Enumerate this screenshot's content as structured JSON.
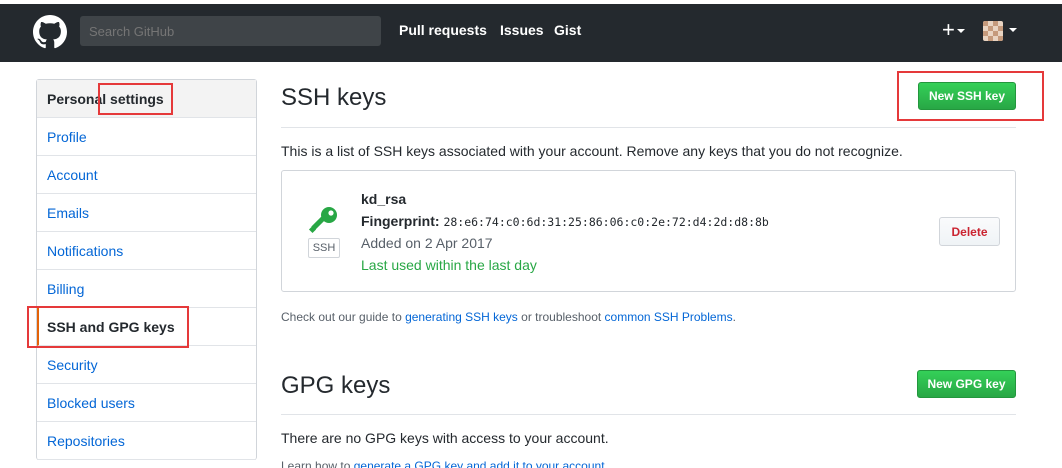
{
  "header": {
    "search_placeholder": "Search GitHub",
    "nav": [
      "Pull requests",
      "Issues",
      "Gist"
    ],
    "plus_label": "+"
  },
  "sidebar": {
    "title": "Personal settings",
    "items": [
      {
        "label": "Profile"
      },
      {
        "label": "Account"
      },
      {
        "label": "Emails"
      },
      {
        "label": "Notifications"
      },
      {
        "label": "Billing"
      },
      {
        "label": "SSH and GPG keys"
      },
      {
        "label": "Security"
      },
      {
        "label": "Blocked users"
      },
      {
        "label": "Repositories"
      }
    ]
  },
  "ssh": {
    "title": "SSH keys",
    "new_button": "New SSH key",
    "description": "This is a list of SSH keys associated with your account. Remove any keys that you do not recognize.",
    "key": {
      "name": "kd_rsa",
      "fingerprint_label": "Fingerprint:",
      "fingerprint": "28:e6:74:c0:6d:31:25:86:06:c0:2e:72:d4:2d:d8:8b",
      "added": "Added on 2 Apr 2017",
      "last_used": "Last used within the last day",
      "type_badge": "SSH",
      "delete_button": "Delete"
    },
    "guide_prefix": "Check out our guide to ",
    "guide_link1": "generating SSH keys",
    "guide_middle": " or troubleshoot ",
    "guide_link2": "common SSH Problems",
    "guide_suffix": "."
  },
  "gpg": {
    "title": "GPG keys",
    "new_button": "New GPG key",
    "empty_text": "There are no GPG keys with access to your account.",
    "learn_prefix": "Learn how to ",
    "learn_link": "generate a GPG key and add it to your account",
    "learn_suffix": "."
  },
  "colors": {
    "header_bg": "#24292e",
    "link": "#0366d6",
    "green": "#28a745",
    "annotation": "#e5393a"
  }
}
